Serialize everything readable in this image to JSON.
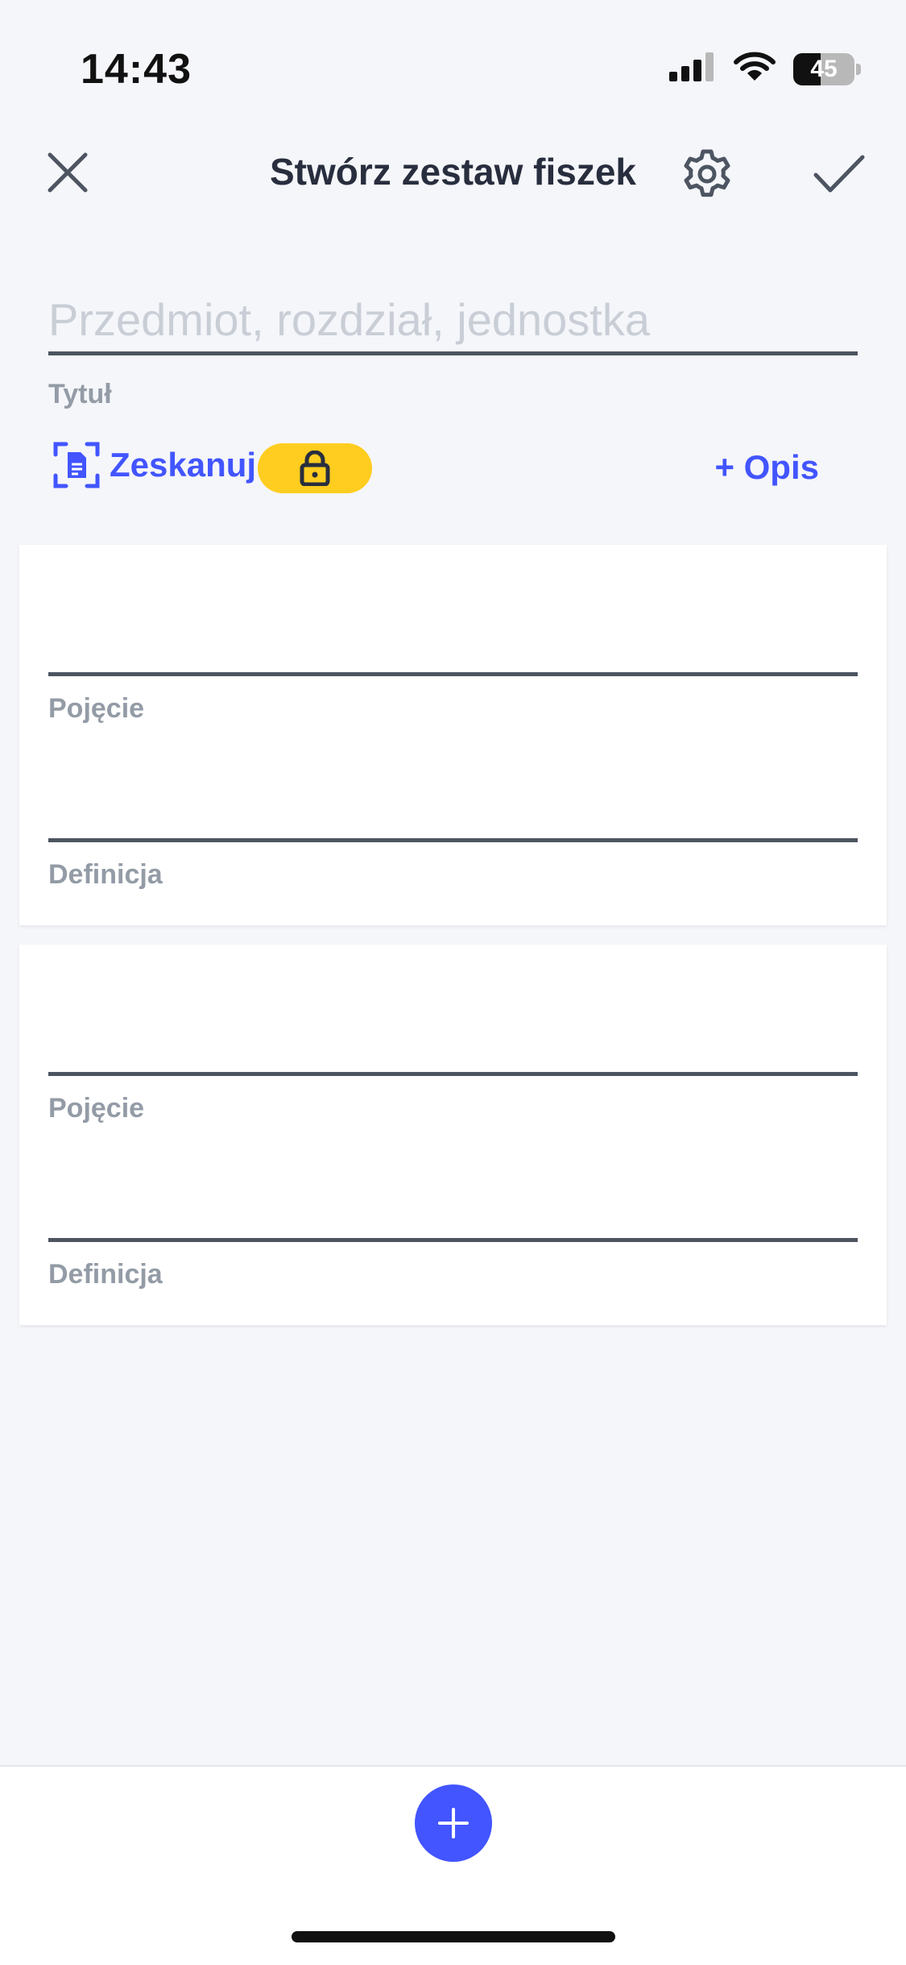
{
  "status_bar": {
    "time": "14:43",
    "battery": "45",
    "icons": [
      "cellular-signal-icon",
      "wifi-icon",
      "battery-icon"
    ]
  },
  "header": {
    "title": "Stwórz zestaw fiszek",
    "icons": [
      "close-icon",
      "gear-icon",
      "check-icon"
    ]
  },
  "title_field": {
    "value": "",
    "placeholder": "Przedmiot, rozdział, jednostka",
    "label": "Tytuł"
  },
  "actions": {
    "scan_label": "Zeskanuj",
    "scan_icon": "document-scan-icon",
    "lock_icon": "lock-icon",
    "description_label": "+ Opis"
  },
  "cards": [
    {
      "term_value": "",
      "term_label": "Pojęcie",
      "definition_value": "",
      "definition_label": "Definicja"
    },
    {
      "term_value": "",
      "term_label": "Pojęcie",
      "definition_value": "",
      "definition_label": "Definicja"
    }
  ],
  "bottom": {
    "add_icon": "plus-icon"
  },
  "colors": {
    "accent": "#4255ff",
    "lock_badge": "#ffcd1f",
    "background": "#f5f6fa",
    "text_dark": "#282e3e",
    "label_gray": "#939ba6",
    "placeholder": "#c9ced6",
    "underline": "#4c5561"
  }
}
